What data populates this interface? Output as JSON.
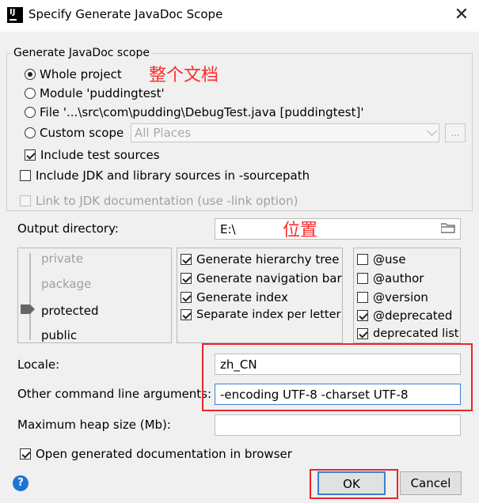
{
  "window": {
    "title": "Specify Generate JavaDoc Scope",
    "app_icon": "IJ",
    "close_label": "✕"
  },
  "scope": {
    "group_title": "Generate JavaDoc scope",
    "options": [
      {
        "label": "Whole project",
        "selected": true
      },
      {
        "label": "Module 'puddingtest'",
        "selected": false
      },
      {
        "label": "File '...\\src\\com\\pudding\\DebugTest.java [puddingtest]'",
        "selected": false
      },
      {
        "label": "Custom scope",
        "selected": false
      }
    ],
    "custom_scope_value": "All Places",
    "more_label": "...",
    "include_test_sources": {
      "label": "Include test sources",
      "checked": true
    }
  },
  "include_jdk": {
    "label": "Include JDK and library sources in -sourcepath",
    "checked": false
  },
  "link_jdk": {
    "label": "Link to JDK documentation (use -link option)",
    "checked": false,
    "enabled": false
  },
  "output": {
    "label": "Output directory:",
    "value": "E:\\"
  },
  "visibility": {
    "levels": [
      "private",
      "package",
      "protected",
      "public"
    ],
    "selected": "protected"
  },
  "generate_options": [
    {
      "label": "Generate hierarchy tree",
      "checked": true
    },
    {
      "label": "Generate navigation bar",
      "checked": true
    },
    {
      "label": "Generate index",
      "checked": true
    },
    {
      "label": "Separate index per letter",
      "checked": true
    }
  ],
  "tag_options": [
    {
      "label": "@use",
      "checked": false
    },
    {
      "label": "@author",
      "checked": false
    },
    {
      "label": "@version",
      "checked": false
    },
    {
      "label": "@deprecated",
      "checked": true
    },
    {
      "label": "deprecated list",
      "checked": true
    }
  ],
  "locale": {
    "label": "Locale:",
    "value": "zh_CN"
  },
  "other_args": {
    "label": "Other command line arguments:",
    "value": "-encoding UTF-8 -charset UTF-8"
  },
  "heap": {
    "label": "Maximum heap size (Mb):",
    "value": ""
  },
  "open_in_browser": {
    "label": "Open generated documentation in browser",
    "checked": true
  },
  "buttons": {
    "ok": "OK",
    "cancel": "Cancel",
    "help": "?"
  },
  "annotations": {
    "whole_doc": "整个文档",
    "location": "位置"
  },
  "colors": {
    "annotation": "#ff2a2a",
    "help": "#1d74d6",
    "ok_border": "#3c7fd1"
  }
}
